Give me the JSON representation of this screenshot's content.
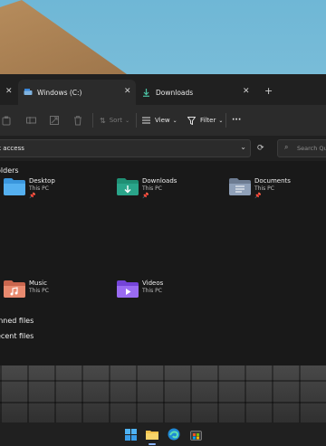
{
  "tabs": [
    {
      "label": "Windows (C:)",
      "icon": "drive-icon"
    },
    {
      "label": "Downloads",
      "icon": "download-icon"
    }
  ],
  "toolbar": {
    "sort_label": "Sort",
    "view_label": "View",
    "filter_label": "Filter",
    "more_label": "···"
  },
  "address": {
    "text": "k access"
  },
  "search": {
    "placeholder": "Search Qu"
  },
  "sections": {
    "folders": "olders",
    "pinned": "inned files",
    "recent": "ecent files"
  },
  "folders": [
    {
      "name": "Desktop",
      "location": "This PC",
      "icon": "desktop-folder-icon",
      "color": "#3a96dd",
      "pinned": true
    },
    {
      "name": "Downloads",
      "location": "This PC",
      "icon": "downloads-folder-icon",
      "color": "#2aa58a",
      "pinned": true
    },
    {
      "name": "Documents",
      "location": "This PC",
      "icon": "documents-folder-icon",
      "color": "#7b8ca3",
      "pinned": true
    },
    {
      "name": "Music",
      "location": "This PC",
      "icon": "music-folder-icon",
      "color": "#e07a5f",
      "pinned": false
    },
    {
      "name": "Videos",
      "location": "This PC",
      "icon": "videos-folder-icon",
      "color": "#8b5cf6",
      "pinned": false
    }
  ],
  "taskbar": [
    "start-icon",
    "file-explorer-icon",
    "edge-icon",
    "store-icon"
  ]
}
